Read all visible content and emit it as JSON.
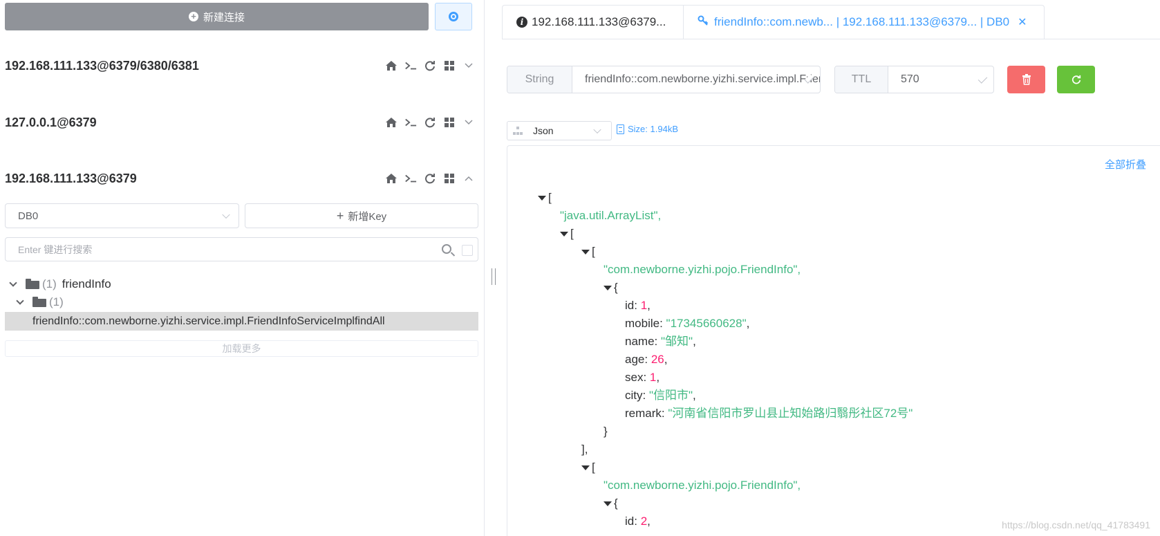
{
  "toolbar": {
    "new_connection_label": "新建连接"
  },
  "connections": [
    {
      "name": "192.168.111.133@6379/6380/6381"
    },
    {
      "name": "127.0.0.1@6379"
    },
    {
      "name": "192.168.111.133@6379"
    }
  ],
  "db_select": {
    "value": "DB0"
  },
  "add_key_label": "新增Key",
  "search": {
    "placeholder": "Enter 键进行搜索"
  },
  "tree": {
    "folder1": {
      "count": "(1)",
      "label": "friendInfo"
    },
    "folder2": {
      "count": "(1)"
    },
    "key": "friendInfo::com.newborne.yizhi.service.impl.FriendInfoServiceImplfindAll"
  },
  "load_more_label": "加载更多",
  "tabs": [
    {
      "label": "192.168.111.133@6379..."
    },
    {
      "label": "friendInfo::com.newb... | 192.168.111.133@6379... | DB0"
    }
  ],
  "key_detail": {
    "type_label": "String",
    "key_value": "friendInfo::com.newborne.yizhi.service.impl.FriendInfoServiceImplfindAll",
    "ttl_label": "TTL",
    "ttl_value": "570"
  },
  "format": {
    "value": "Json"
  },
  "size_label": "Size: 1.94kB",
  "collapse_all_label": "全部折叠",
  "json": {
    "open": "[",
    "type_array": "\"java.util.ArrayList\",",
    "item1_type": "\"com.newborne.yizhi.pojo.FriendInfo\",",
    "id_key": "id: ",
    "id_val": "1",
    "mobile_key": "mobile: ",
    "mobile_val": "\"17345660628\"",
    "name_key": "name: ",
    "name_val": "\"邹知\"",
    "age_key": "age: ",
    "age_val": "26",
    "sex_key": "sex: ",
    "sex_val": "1",
    "city_key": "city: ",
    "city_val": "\"信阳市\"",
    "remark_key": "remark: ",
    "remark_val": "\"河南省信阳市罗山县止知始路归翳彤社区72号\"",
    "close_brace": "}",
    "close_bracket_comma": "],",
    "item2_type": "\"com.newborne.yizhi.pojo.FriendInfo\",",
    "id2_val": "2"
  },
  "watermark": "https://blog.csdn.net/qq_41783491",
  "colors": {
    "accent": "#409eff",
    "danger": "#f56c6c",
    "success": "#67c23a",
    "string": "#42b983",
    "number": "#fc1e70"
  }
}
